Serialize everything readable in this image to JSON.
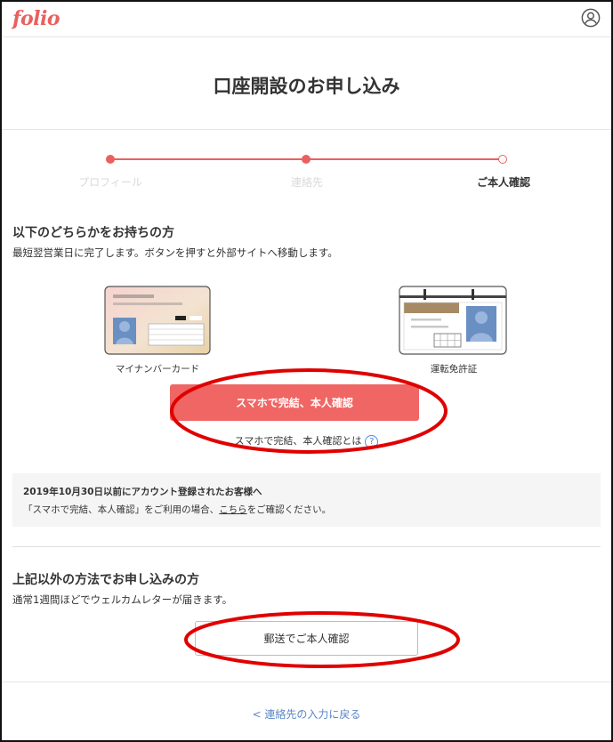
{
  "brand": {
    "logo_text": "folio",
    "accent_color": "#e8615f"
  },
  "header": {
    "account_icon": "account-circle-icon"
  },
  "page": {
    "title": "口座開設のお申し込み"
  },
  "stepper": {
    "steps": [
      {
        "label": "プロフィール",
        "state": "done"
      },
      {
        "label": "連絡先",
        "state": "done"
      },
      {
        "label": "ご本人確認",
        "state": "current"
      }
    ]
  },
  "section1": {
    "title": "以下のどちらかをお持ちの方",
    "description": "最短翌営業日に完了します。ボタンを押すと外部サイトへ移動します。",
    "cards": [
      {
        "label": "マイナンバーカード",
        "icon": "my-number-card-icon"
      },
      {
        "label": "運転免許証",
        "icon": "drivers-license-icon"
      }
    ],
    "primary_button": "スマホで完結、本人確認",
    "help_link": "スマホで完結、本人確認とは",
    "help_icon": "?"
  },
  "notice": {
    "title": "2019年10月30日以前にアカウント登録されたお客様へ",
    "text_before": "「スマホで完結、本人確認」をご利用の場合、",
    "link": "こちら",
    "text_after": "をご確認ください。"
  },
  "section2": {
    "title": "上記以外の方法でお申し込みの方",
    "description": "通常1週間ほどでウェルカムレターが届きます。",
    "secondary_button": "郵送でご本人確認"
  },
  "footer": {
    "back_link": "< 連絡先の入力に戻る"
  },
  "annotation_color": "#e00000"
}
